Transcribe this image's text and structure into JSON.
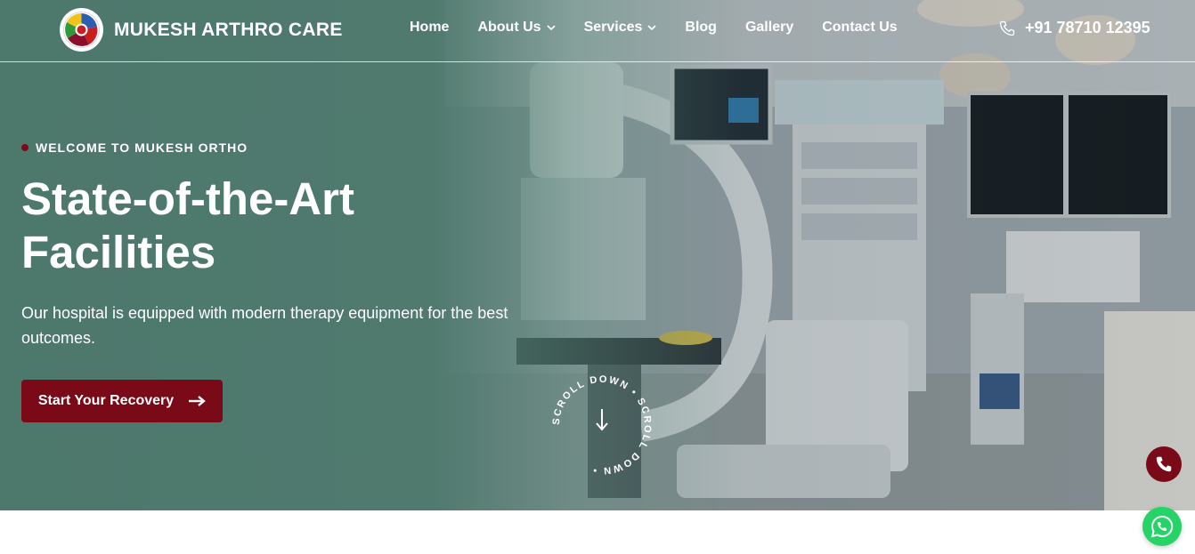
{
  "brand": {
    "name": "MUKESH ARTHRO CARE",
    "logo_icon": "multicolor-ortho-logo"
  },
  "nav": {
    "items": [
      {
        "label": "Home",
        "dropdown": false
      },
      {
        "label": "About Us",
        "dropdown": true
      },
      {
        "label": "Services",
        "dropdown": true
      },
      {
        "label": "Blog",
        "dropdown": false
      },
      {
        "label": "Gallery",
        "dropdown": false
      },
      {
        "label": "Contact Us",
        "dropdown": false
      }
    ],
    "phone": "+91 78710 12395",
    "phone_icon": "phone-icon"
  },
  "hero": {
    "eyebrow": "WELCOME TO MUKESH ORTHO",
    "headline": "State-of-the-Art Facilities",
    "description": "Our hospital is equipped with modern therapy equipment for the best outcomes.",
    "cta_label": "Start Your Recovery",
    "cta_icon": "arrow-right-icon",
    "scroll_text": "SCROLL DOWN • SCROLL DOWN •",
    "background": "operating-room-photo"
  },
  "floating": {
    "call_icon": "phone-icon",
    "whatsapp_icon": "whatsapp-icon"
  },
  "colors": {
    "accent": "#7a0a17",
    "overlay": "#4d786c",
    "whatsapp": "#25d366"
  }
}
